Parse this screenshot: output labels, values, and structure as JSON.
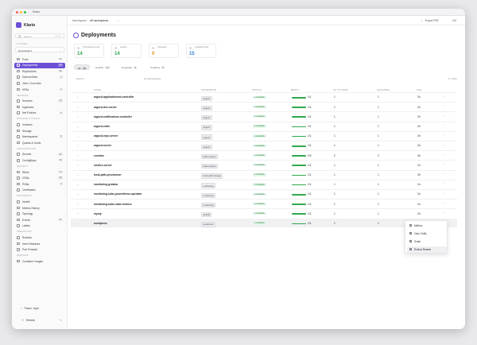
{
  "app": {
    "title": "Klario",
    "brand": "Klario"
  },
  "sidebar": {
    "search_label": "Search",
    "search_shortcut": "⌘K",
    "cluster_section": "CLUSTER",
    "cluster_value": "kind-cluster1",
    "groups": [
      {
        "title": "",
        "items": [
          {
            "label": "Pods",
            "count": "27"
          },
          {
            "label": "Deployments",
            "count": "14",
            "active": true
          },
          {
            "label": "ReplicaSets",
            "count": "28"
          },
          {
            "label": "DaemonSets",
            "count": "3"
          },
          {
            "label": "Jobs / CronJobs",
            "count": ""
          },
          {
            "label": "HPAs",
            "count": "0"
          }
        ]
      },
      {
        "title": "NETWORK",
        "items": [
          {
            "label": "Services",
            "count": "19"
          },
          {
            "label": "Ingresses",
            "count": ""
          },
          {
            "label": "Net Policies",
            "count": "0"
          }
        ]
      },
      {
        "title": "STORAGE & CONFIG",
        "items": [
          {
            "label": "Volumes",
            "count": ""
          },
          {
            "label": "Storage",
            "count": ""
          },
          {
            "label": "Namespaces",
            "count": "8"
          },
          {
            "label": "Quotas & Limits",
            "count": ""
          }
        ]
      },
      {
        "title": "CONFIGURATION",
        "items": [
          {
            "label": "Secrets",
            "count": "22"
          },
          {
            "label": "ConfigMaps",
            "count": "18"
          }
        ]
      },
      {
        "title": "SECURITY",
        "items": [
          {
            "label": "RBAC",
            "count": "73"
          },
          {
            "label": "CRDs",
            "count": "28"
          },
          {
            "label": "PDBs",
            "count": "0"
          },
          {
            "label": "Certificates",
            "count": ""
          }
        ]
      },
      {
        "title": "MONITORING",
        "items": [
          {
            "label": "Health",
            "count": ""
          },
          {
            "label": "Metrics History",
            "count": ""
          },
          {
            "label": "Topology",
            "count": ""
          },
          {
            "label": "Events",
            "count": "25"
          },
          {
            "label": "Labels",
            "count": ""
          }
        ]
      },
      {
        "title": "OPERATIONS",
        "items": [
          {
            "label": "Rollouts",
            "count": ""
          },
          {
            "label": "Helm Releases",
            "count": ""
          },
          {
            "label": "Port Forward",
            "count": ""
          }
        ]
      },
      {
        "title": "SERVICES",
        "items": [
          {
            "label": "Container Images",
            "count": ""
          }
        ]
      }
    ],
    "theme_label": "Theme: Light",
    "fold_label": "Refresh"
  },
  "topbar": {
    "crumb_ns": "Namespace",
    "crumb_all": "All namespaces",
    "export": "Export PDF",
    "user": "CN"
  },
  "page": {
    "title": "Deployments",
    "stats": [
      {
        "label": "Total Deployments",
        "value": "14",
        "color": "#2fa84f"
      },
      {
        "label": "Healthy",
        "value": "14",
        "color": "#2fa84f"
      },
      {
        "label": "Degraded",
        "value": "0",
        "color": "#e08a1c"
      },
      {
        "label": "Available Pods",
        "value": "15",
        "color": "#2a7fd6"
      }
    ],
    "tabs": [
      {
        "label": "All",
        "count": "14",
        "active": true
      },
      {
        "label": "Healthy",
        "count": "14"
      },
      {
        "label": "Degraded",
        "count": "0"
      },
      {
        "label": "Updating",
        "count": "0"
      }
    ],
    "filter_search": "Search",
    "filter_ns": "All namespaces",
    "filter_right": "≡ 1 KEY",
    "columns": [
      "NAME",
      "NAMESPACE",
      "STATUS",
      "READY",
      "UP-TO-DATE",
      "AVAILABLE",
      "AGE"
    ]
  },
  "rows": [
    {
      "name": "argocd-applicationset-controller",
      "ns": "argocd",
      "status": "● Available",
      "ready": "1/1",
      "ready_frac": 1,
      "uptodate": "1",
      "available": "1",
      "age": "2h"
    },
    {
      "name": "argocd-dex-server",
      "ns": "argocd",
      "status": "● Available",
      "ready": "1/1",
      "ready_frac": 1,
      "uptodate": "1",
      "available": "1",
      "age": "2h"
    },
    {
      "name": "argocd-notifications-controller",
      "ns": "argocd",
      "status": "● Available",
      "ready": "1/1",
      "ready_frac": 1,
      "uptodate": "1",
      "available": "1",
      "age": "2h"
    },
    {
      "name": "argocd-redis",
      "ns": "argocd",
      "status": "● Available",
      "ready": "1/1",
      "ready_frac": 1,
      "uptodate": "1",
      "available": "1",
      "age": "2h"
    },
    {
      "name": "argocd-repo-server",
      "ns": "argocd",
      "status": "● Available",
      "ready": "1/1",
      "ready_frac": 1,
      "uptodate": "1",
      "available": "1",
      "age": "2h"
    },
    {
      "name": "argocd-server",
      "ns": "argocd",
      "status": "● Available",
      "ready": "1/1",
      "ready_frac": 1,
      "uptodate": "1",
      "available": "1",
      "age": "2h"
    },
    {
      "name": "coredns",
      "ns": "kube-system",
      "status": "● Available",
      "ready": "2/2",
      "ready_frac": 1,
      "uptodate": "2",
      "available": "2",
      "age": "3h"
    },
    {
      "name": "metrics-server",
      "ns": "kube-system",
      "status": "● Available",
      "ready": "1/1",
      "ready_frac": 1,
      "uptodate": "1",
      "available": "1",
      "age": "1h"
    },
    {
      "name": "local-path-provisioner",
      "ns": "local-path-storage",
      "status": "● Available",
      "ready": "1/1",
      "ready_frac": 1,
      "uptodate": "1",
      "available": "1",
      "age": "3h"
    },
    {
      "name": "monitoring-grafana",
      "ns": "monitoring",
      "status": "● Available",
      "ready": "1/1",
      "ready_frac": 1,
      "uptodate": "1",
      "available": "1",
      "age": "1h"
    },
    {
      "name": "monitoring-kube-prometheus-operator",
      "ns": "monitoring",
      "status": "● Available",
      "ready": "1/1",
      "ready_frac": 1,
      "uptodate": "1",
      "available": "1",
      "age": "1h"
    },
    {
      "name": "monitoring-kube-state-metrics",
      "ns": "monitoring",
      "status": "● Available",
      "ready": "1/1",
      "ready_frac": 1,
      "uptodate": "1",
      "available": "1",
      "age": "1h"
    },
    {
      "name": "mysql",
      "ns": "default",
      "status": "● Available",
      "ready": "1/1",
      "ready_frac": 1,
      "uptodate": "1",
      "available": "1",
      "age": "2h"
    },
    {
      "name": "wordpress",
      "ns": "wordpress",
      "status": "● Available",
      "ready": "1/1",
      "ready_frac": 1,
      "uptodate": "1",
      "available": "1",
      "age": "2h"
    }
  ],
  "context_menu": {
    "items": [
      "Metrics",
      "View YAML",
      "Scale",
      "Rollout Restart"
    ]
  }
}
